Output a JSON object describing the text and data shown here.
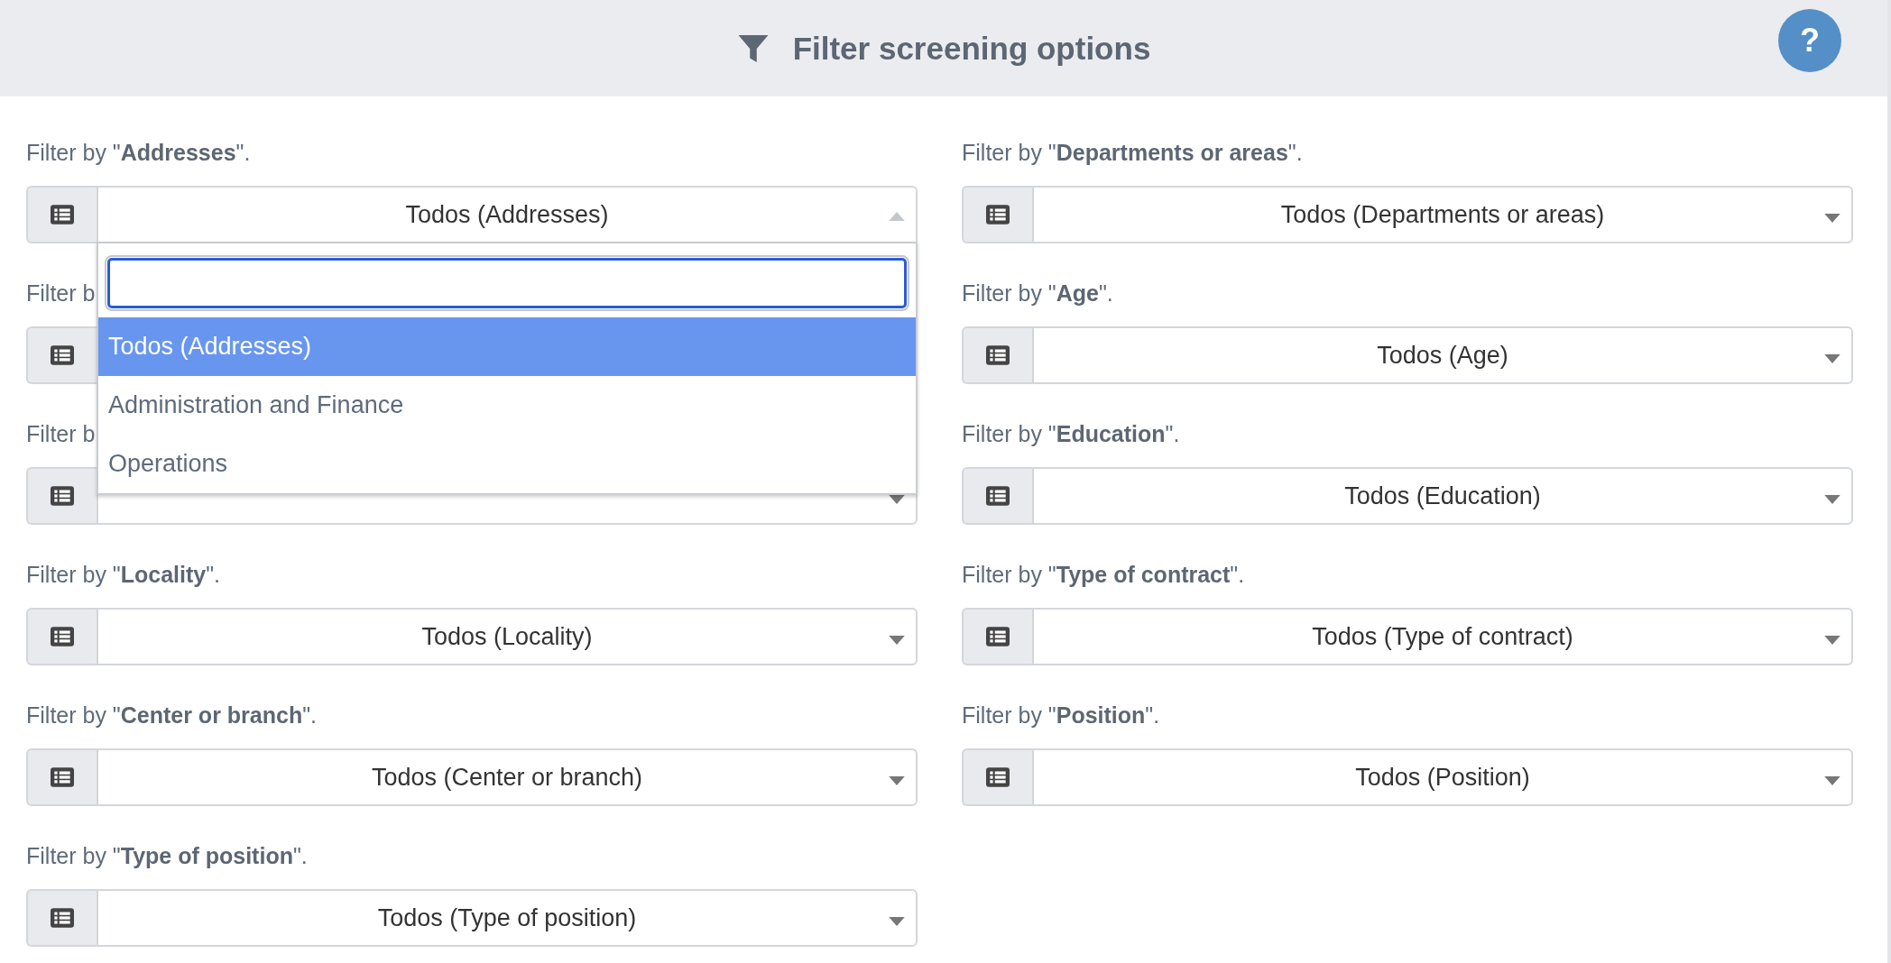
{
  "header": {
    "title": "Filter screening options",
    "help_button": "?"
  },
  "columns": [
    {
      "filters": [
        {
          "label": "Filter by \"**Addresses**\".",
          "value": "Todos (Addresses)",
          "expanded": true,
          "dropdown": {
            "options": [
              {
                "label": "Todos (Addresses)",
                "selected": true
              },
              {
                "label": "Administration and Finance",
                "selected": false
              },
              {
                "label": "Operations",
                "selected": false
              }
            ]
          }
        },
        {
          "label": "Filter b"
        },
        {
          "label": "Filter b"
        },
        {
          "label": "Filter by \"**Locality**\".",
          "value": "Todos (Locality)",
          "expanded": false
        },
        {
          "label": "Filter by \"**Center or branch**\".",
          "value": "Todos (Center or branch)",
          "expanded": false
        },
        {
          "label": "Filter by \"**Type of position**\".",
          "value": "Todos (Type of position)",
          "expanded": false
        }
      ]
    },
    {
      "filters": [
        {
          "label": "Filter by \"**Departments or areas**\".",
          "value": "Todos (Departments or areas)",
          "expanded": false
        },
        {
          "label": "Filter by \"**Age**\".",
          "value": "Todos (Age)",
          "expanded": false
        },
        {
          "label": "Filter by \"**Education**\".",
          "value": "Todos (Education)",
          "expanded": false
        },
        {
          "label": "Filter by \"**Type of contract**\".",
          "value": "Todos (Type of contract)",
          "expanded": false
        },
        {
          "label": "Filter by \"**Position**\".",
          "value": "Todos (Position)",
          "expanded": false
        }
      ]
    }
  ]
}
